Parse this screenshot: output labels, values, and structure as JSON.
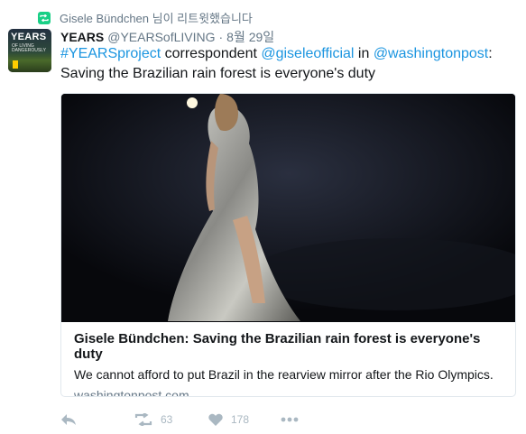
{
  "retweet": {
    "text": "Gisele Bündchen 님이 리트윗했습니다",
    "icon": "retweet-icon",
    "color": "#19cf86"
  },
  "tweet": {
    "avatar_text": "YEARS",
    "avatar_subtext": "OF LIVING DANGEROUSLY",
    "display_name": "YEARS",
    "handle": "@YEARSofLIVING",
    "separator": "·",
    "time": "8월 29일",
    "text": {
      "hashtag": "#YEARSproject",
      "word1": " correspondent ",
      "mention1": "@giseleofficial",
      "word2": " in ",
      "mention2": "@washingtonpost",
      "word3": ":",
      "line2": "Saving the Brazilian rain forest is everyone's duty"
    },
    "link_color": "#1b95e0"
  },
  "card": {
    "title": "Gisele Bündchen: Saving the Brazilian rain forest is everyone's duty",
    "description": "We cannot afford to put Brazil in the rearview mirror after the Rio Olympics.",
    "domain": "washingtonpost.com",
    "image": "runway-photo"
  },
  "actions": {
    "reply_icon": "reply-icon",
    "retweet_icon": "retweet-icon",
    "retweet_count": "63",
    "like_icon": "heart-icon",
    "like_count": "178",
    "more_icon": "more-icon"
  }
}
